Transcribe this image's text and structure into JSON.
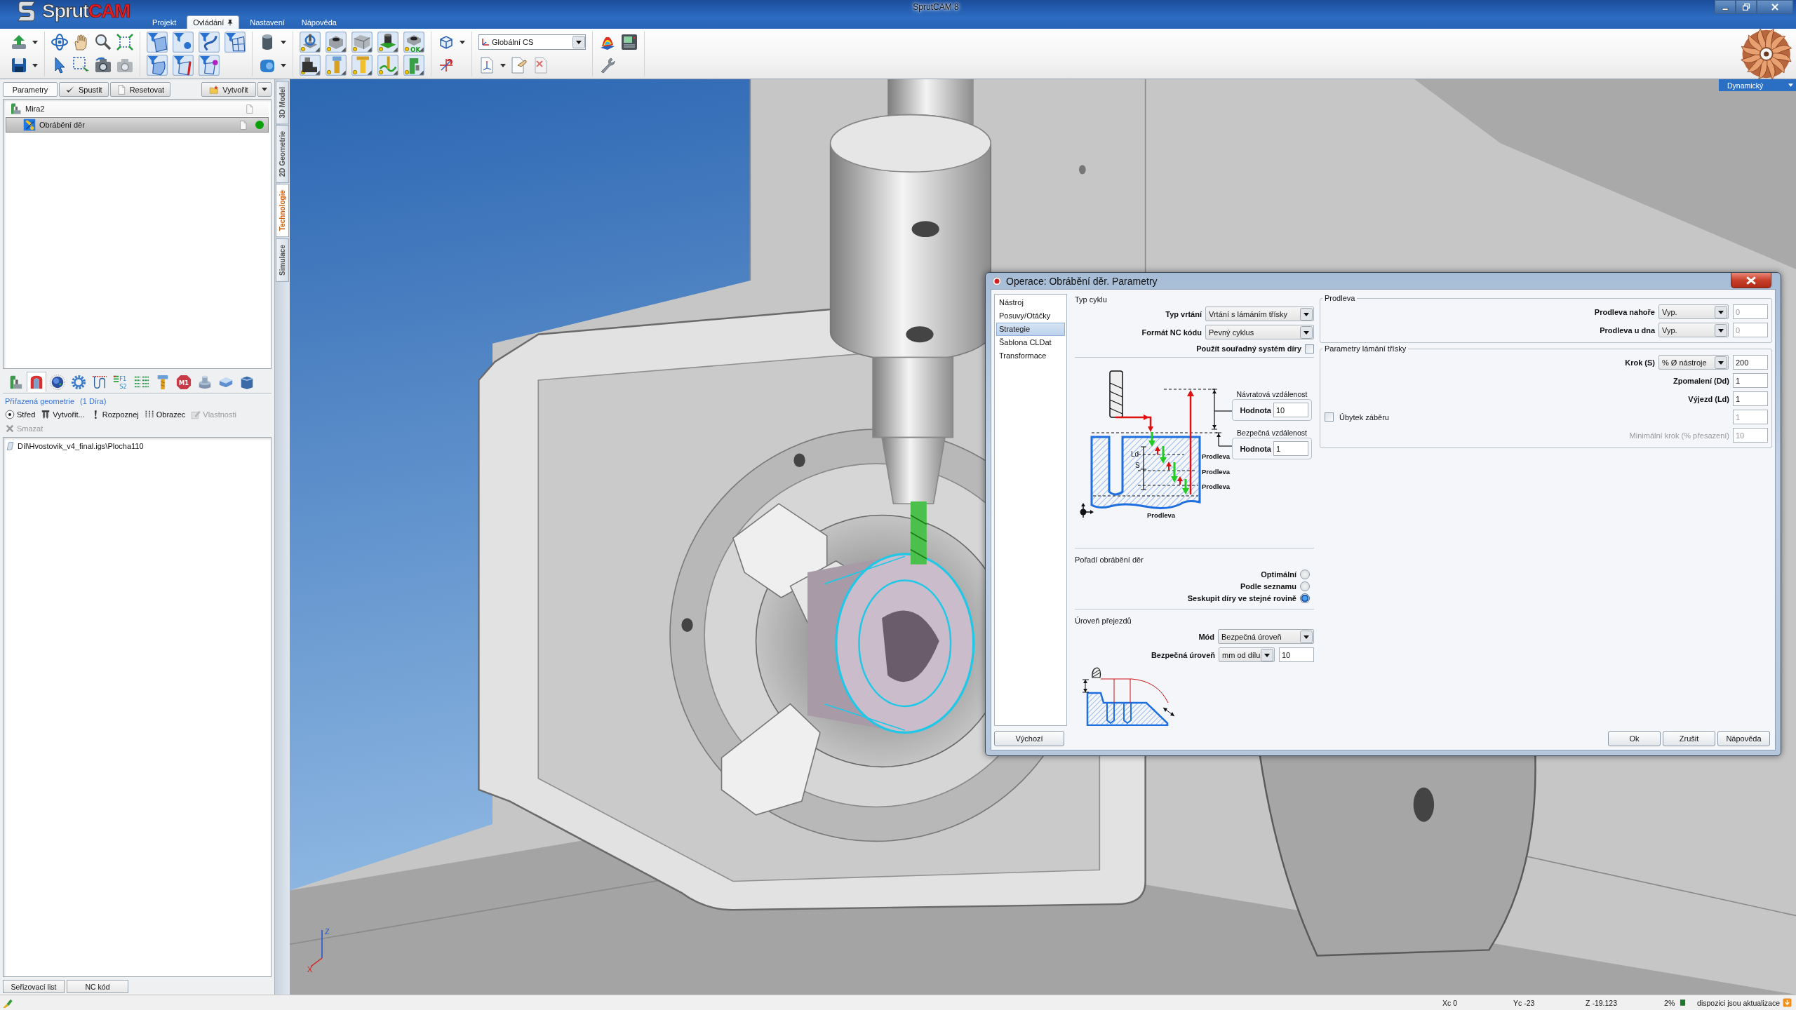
{
  "window": {
    "logo": {
      "name": "Sprut",
      "accent": "CAM"
    },
    "title": "SprutCAM 8"
  },
  "menu_tabs": [
    {
      "label": "Projekt",
      "selected": false
    },
    {
      "label": "Ovládání",
      "selected": true
    },
    {
      "label": "Nastavení",
      "selected": false
    },
    {
      "label": "Nápověda",
      "selected": false
    }
  ],
  "toolbar": {
    "check_badge": "OK",
    "coordinate_system": "Globální CS"
  },
  "left_panel": {
    "top_buttons": [
      {
        "label": "Parametry",
        "kind": "plain"
      },
      {
        "label": "Spustit",
        "kind": "run"
      },
      {
        "label": "Resetovat",
        "kind": "reset"
      },
      {
        "label": "Vytvořit",
        "kind": "create"
      }
    ],
    "operations_tree": [
      {
        "label": "Mira2",
        "selected": false,
        "children": [
          {
            "label": "Obrábění děr",
            "selected": true,
            "color": "#0aa00a"
          }
        ]
      }
    ],
    "icon_tabs": [
      {
        "kind": "machine",
        "selected": false
      },
      {
        "kind": "geometry",
        "selected": true
      },
      {
        "kind": "dial",
        "selected": false
      },
      {
        "kind": "gear",
        "selected": false
      },
      {
        "kind": "path",
        "selected": false
      },
      {
        "kind": "feeds",
        "selected": false,
        "texts": [
          "F1",
          "S2"
        ]
      },
      {
        "kind": "list",
        "selected": false
      },
      {
        "kind": "tool",
        "selected": false
      },
      {
        "kind": "mcode",
        "selected": false,
        "texts": [
          "M1"
        ]
      },
      {
        "kind": "part",
        "selected": false
      },
      {
        "kind": "block",
        "selected": false
      },
      {
        "kind": "fixture",
        "selected": false
      }
    ],
    "geometry": {
      "title": "Přiřazená geometrie",
      "count": "(1 Díra)",
      "actions": [
        {
          "label": "Střed",
          "kind": "center",
          "disabled": false
        },
        {
          "label": "Vytvořit...",
          "kind": "create",
          "disabled": false
        },
        {
          "label": "Rozpoznej",
          "kind": "recognize",
          "disabled": false
        },
        {
          "label": "Obrazec",
          "kind": "pattern",
          "disabled": false
        },
        {
          "label": "Vlastnosti",
          "kind": "properties",
          "disabled": true
        },
        {
          "label": "Smazat",
          "kind": "delete",
          "disabled": true
        }
      ],
      "items": [
        "Díl\\Hvostovik_v4_final.igs\\Plocha110"
      ]
    },
    "bottom_tabs": [
      {
        "label": "Seřizovací list",
        "selected": false
      },
      {
        "label": "NC kód",
        "selected": false
      }
    ]
  },
  "side_tabs": [
    {
      "label": "3D Model",
      "selected": false
    },
    {
      "label": "2D Geometrie",
      "selected": false
    },
    {
      "label": "Technologie",
      "selected": true
    },
    {
      "label": "Simulace",
      "selected": false
    }
  ],
  "view": {
    "mode": "Dynamický",
    "axes": [
      "Z",
      "X"
    ]
  },
  "dialog": {
    "title": "Operace: Obrábění děr. Parametry",
    "nav": [
      {
        "label": "Nástroj",
        "selected": false
      },
      {
        "label": "Posuvy/Otáčky",
        "selected": false
      },
      {
        "label": "Strategie",
        "selected": true
      },
      {
        "label": "Šablona CLDat",
        "selected": false
      },
      {
        "label": "Transformace",
        "selected": false
      }
    ],
    "default_button": "Výchozí",
    "cycle": {
      "title": "Typ cyklu",
      "fields": [
        {
          "label": "Typ vrtání",
          "value": "Vrtání s lámáním třísky"
        },
        {
          "label": "Formát NC kódu",
          "value": "Pevný cyklus"
        }
      ],
      "use_hole_cs": {
        "label": "Použít souřadný systém díry",
        "checked": false
      }
    },
    "diagram": {
      "ld": "Ld",
      "s": "S",
      "dwell_labels": [
        "Prodleva",
        "Prodleva",
        "Prodleva",
        "Prodleva"
      ],
      "return": {
        "title": "Návratová vzdálenost",
        "label": "Hodnota",
        "value": "10"
      },
      "safe": {
        "title": "Bezpečná vzdálenost",
        "label": "Hodnota",
        "value": "1"
      }
    },
    "order": {
      "title": "Pořadí obrábění děr",
      "options": [
        {
          "label": "Optimální",
          "selected": false
        },
        {
          "label": "Podle seznamu",
          "selected": false
        },
        {
          "label": "Seskupit díry ve stejné rovině",
          "selected": true
        }
      ]
    },
    "transit": {
      "title": "Úroveň přejezdů",
      "mode": {
        "label": "Mód",
        "value": "Bezpečná úroveň"
      },
      "safe_level": {
        "label": "Bezpečná úroveň",
        "unit": "mm od dílu",
        "value": "10"
      }
    },
    "dwell": {
      "title": "Prodleva",
      "rows": [
        {
          "label": "Prodleva nahoře",
          "value": "Vyp.",
          "amount": "0",
          "disabled": true
        },
        {
          "label": "Prodleva u dna",
          "value": "Vyp.",
          "amount": "0",
          "disabled": true
        }
      ]
    },
    "chip_break": {
      "title": "Parametry lámání třísky",
      "rows": [
        {
          "kind": "combo",
          "label": "Krok (S)",
          "option": "% Ø nástroje",
          "value": "200",
          "disabled": false
        },
        {
          "kind": "input",
          "label": "Zpomalení (Dd)",
          "value": "1",
          "disabled": false
        },
        {
          "kind": "input",
          "label": "Výjezd (Ld)",
          "value": "1",
          "disabled": false
        },
        {
          "kind": "checkbox",
          "label": "Úbytek záběru",
          "checked": false,
          "value": "1",
          "disabled": true
        },
        {
          "kind": "input",
          "label": "Minimální krok (% přesazení)",
          "value": "10",
          "disabled": true
        }
      ]
    },
    "buttons": [
      "Ok",
      "Zrušit",
      "Nápověda"
    ]
  },
  "status_bar": {
    "coords": [
      "Xc 0",
      "Yc -23",
      "Z -19.123"
    ],
    "progress": "2%",
    "message": "dispozici jsou aktualizace"
  }
}
